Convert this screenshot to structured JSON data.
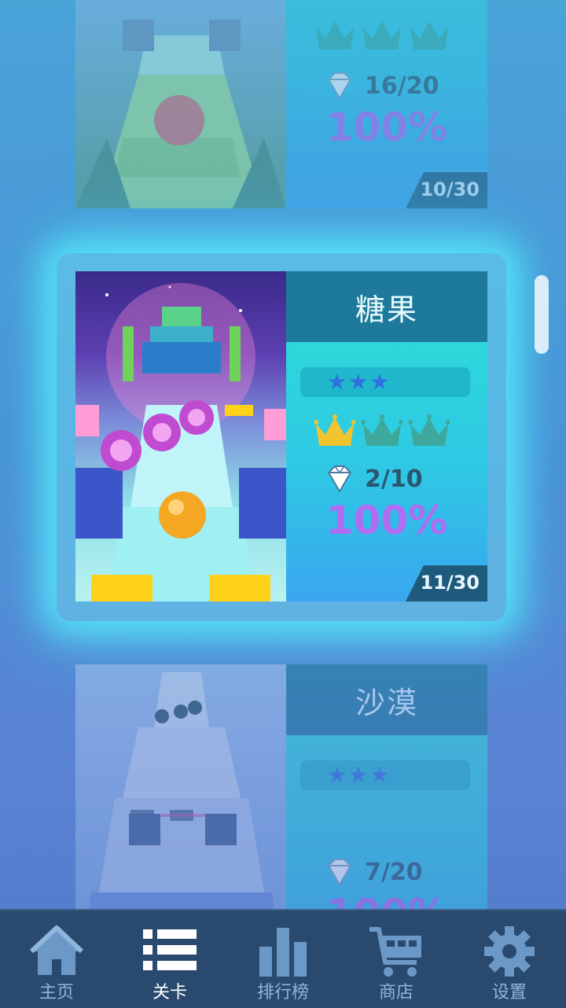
{
  "levels": [
    {
      "name": "",
      "stars": "★★★",
      "crowns_earned": 0,
      "gems": "16/20",
      "percent": "100%",
      "number": "10/30"
    },
    {
      "name": "糖果",
      "stars": "★★★",
      "crowns_earned": 1,
      "gems": "2/10",
      "percent": "100%",
      "number": "11/30"
    },
    {
      "name": "沙漠",
      "stars": "★★★",
      "crowns_earned": 0,
      "gems": "7/20",
      "percent": "100%",
      "number": ""
    }
  ],
  "colors": {
    "crown_gold": "#f4c430",
    "crown_empty": "#3fa89c",
    "percent": "#b06cf2",
    "nav_bg": "#294a6e"
  },
  "nav": {
    "items": [
      {
        "label": "主页",
        "icon": "home-icon"
      },
      {
        "label": "关卡",
        "icon": "list-icon"
      },
      {
        "label": "排行榜",
        "icon": "leaderboard-icon"
      },
      {
        "label": "商店",
        "icon": "cart-icon"
      },
      {
        "label": "设置",
        "icon": "gear-icon"
      }
    ],
    "active_index": 1
  }
}
